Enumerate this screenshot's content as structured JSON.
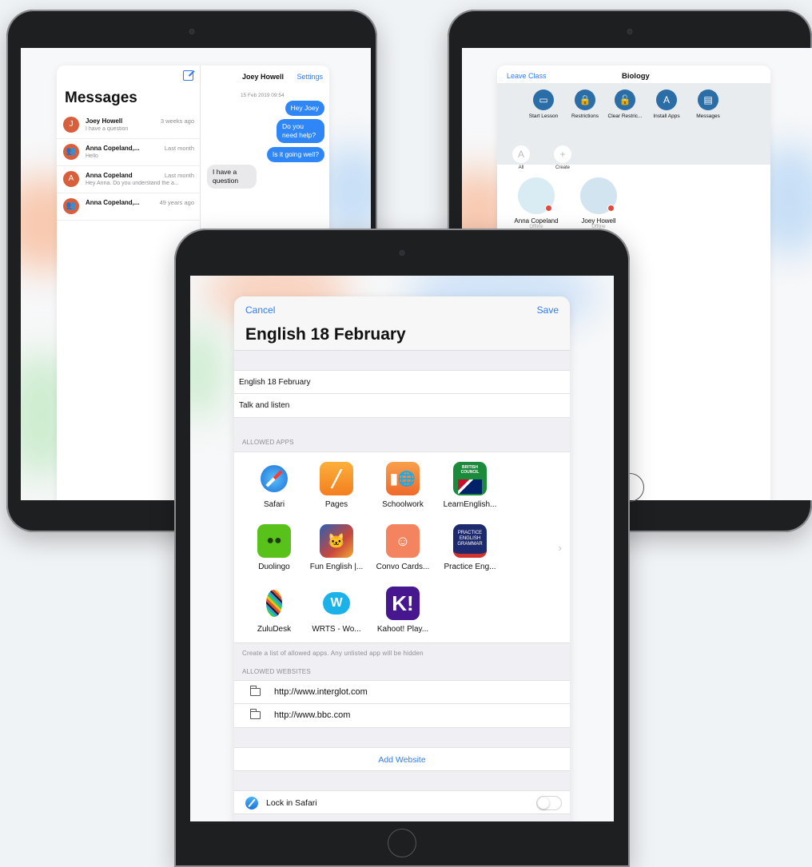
{
  "messages_app": {
    "title": "Messages",
    "conversations": [
      {
        "initial": "J",
        "name": "Joey Howell",
        "time": "3 weeks ago",
        "preview": "I have a question"
      },
      {
        "initial": "",
        "name": "Anna Copeland,...",
        "time": "Last month",
        "preview": "Hello"
      },
      {
        "initial": "A",
        "name": "Anna Copeland",
        "time": "Last month",
        "preview": "Hey Anna. Do you understand the a..."
      },
      {
        "initial": "",
        "name": "Anna Copeland,...",
        "time": "49 years ago",
        "preview": ""
      }
    ],
    "chat": {
      "name": "Joey Howell",
      "settings_label": "Settings",
      "date": "15 Feb 2019 09:54",
      "bubbles": [
        {
          "dir": "out",
          "text": "Hey Joey"
        },
        {
          "dir": "out",
          "text": "Do you need help?"
        },
        {
          "dir": "out",
          "text": "Is it going well?"
        },
        {
          "dir": "in",
          "text": "I have a question"
        }
      ]
    }
  },
  "class_app": {
    "leave_label": "Leave Class",
    "title": "Biology",
    "tools": [
      {
        "label": "Start Lesson",
        "icon": "screen-icon"
      },
      {
        "label": "Restrictions",
        "icon": "lock-icon"
      },
      {
        "label": "Clear Restric...",
        "icon": "unlock-icon"
      },
      {
        "label": "Install Apps",
        "icon": "app-store-icon"
      },
      {
        "label": "Messages",
        "icon": "message-icon"
      }
    ],
    "filters": [
      {
        "glyph": "A",
        "label": "All"
      },
      {
        "glyph": "+",
        "label": "Create"
      }
    ],
    "students": [
      {
        "name": "Anna Copeland",
        "status": "Offline"
      },
      {
        "name": "Joey Howell",
        "status": "Offline"
      }
    ]
  },
  "lesson_sheet": {
    "cancel_label": "Cancel",
    "save_label": "Save",
    "title": "English 18 February",
    "name_value": "English 18 February",
    "description_value": "Talk and listen",
    "allowed_apps_label": "ALLOWED APPS",
    "apps": [
      {
        "name": "Safari",
        "icon": "safari-icon",
        "color": "#1e7ae6"
      },
      {
        "name": "Pages",
        "icon": "pages-icon",
        "color": "#f59a22"
      },
      {
        "name": "Schoolwork",
        "icon": "schoolwork-icon",
        "color": "#f0833a"
      },
      {
        "name": "LearnEnglish...",
        "icon": "learnenglish-icon",
        "color": "#1b8a3a"
      },
      {
        "name": "Duolingo",
        "icon": "duolingo-icon",
        "color": "#58c21a"
      },
      {
        "name": "Fun English |...",
        "icon": "fun-english-icon",
        "color": "#c9473c"
      },
      {
        "name": "Convo Cards...",
        "icon": "convo-cards-icon",
        "color": "#f4845f"
      },
      {
        "name": "Practice Eng...",
        "icon": "practice-english-icon",
        "color": "#1d2a6d"
      },
      {
        "name": "ZuluDesk",
        "icon": "zuludesk-icon",
        "color": "#ffffff"
      },
      {
        "name": "WRTS - Wo...",
        "icon": "wrts-icon",
        "color": "#ffffff"
      },
      {
        "name": "Kahoot! Play...",
        "icon": "kahoot-icon",
        "color": "#46178f"
      }
    ],
    "practice_icon_text": "PRACTICE ENGLISH GRAMMAR",
    "british_council_text": "BRITISH COUNCIL",
    "kahoot_glyph": "K!",
    "wrts_glyph": "W",
    "apps_footer": "Create a list of allowed apps. Any unlisted app will be hidden",
    "allowed_websites_label": "ALLOWED WEBSITES",
    "websites": [
      "http://www.interglot.com",
      "http://www.bbc.com"
    ],
    "add_website_label": "Add Website",
    "lock_label": "Lock in Safari",
    "lock_enabled": false
  }
}
